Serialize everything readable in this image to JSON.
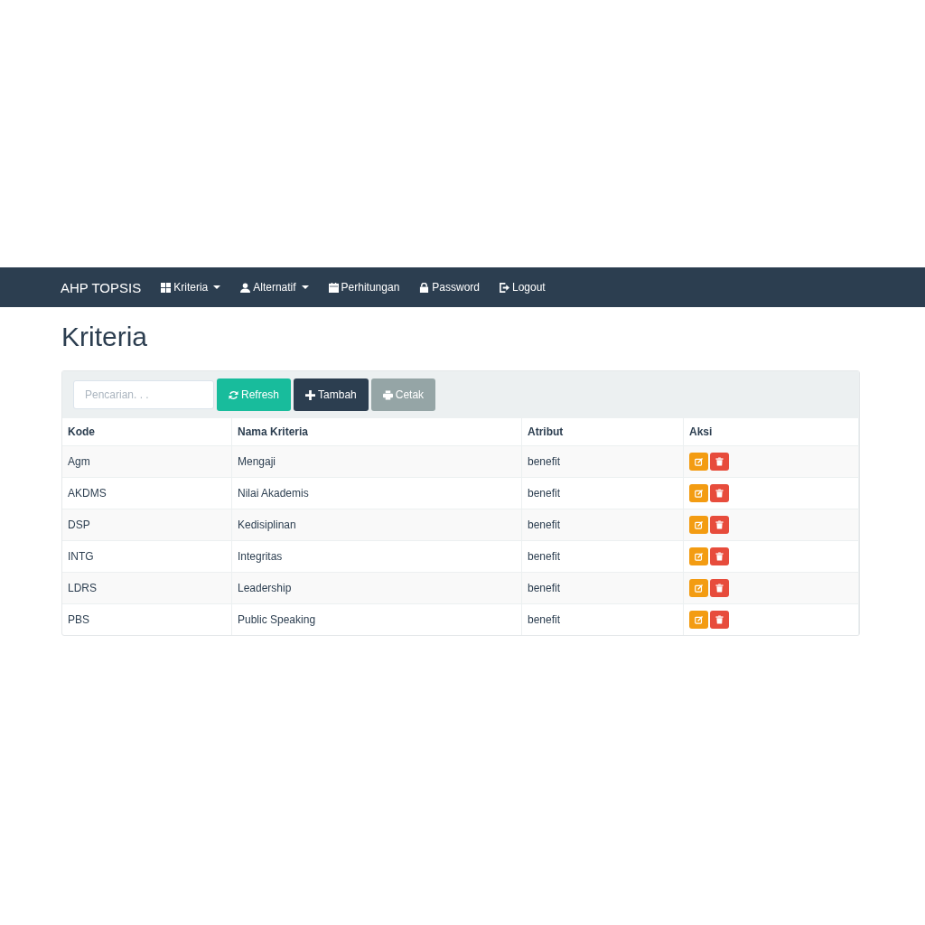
{
  "navbar": {
    "brand": "AHP TOPSIS",
    "items": [
      {
        "label": "Kriteria",
        "kind": "grid",
        "dropdown": true
      },
      {
        "label": "Alternatif",
        "kind": "user",
        "dropdown": true
      },
      {
        "label": "Perhitungan",
        "kind": "calendar",
        "dropdown": false
      },
      {
        "label": "Password",
        "kind": "lock",
        "dropdown": false
      },
      {
        "label": "Logout",
        "kind": "logout",
        "dropdown": false
      }
    ]
  },
  "page_title": "Kriteria",
  "toolbar": {
    "search": {
      "placeholder": "Pencarian. . ."
    },
    "buttons": [
      {
        "label": "Refresh",
        "kind": "refresh"
      },
      {
        "label": "Tambah",
        "kind": "add"
      },
      {
        "label": "Cetak",
        "kind": "print"
      }
    ]
  },
  "table": {
    "columns": [
      "Kode",
      "Nama Kriteria",
      "Atribut",
      "Aksi"
    ],
    "rows": [
      {
        "kode": "Agm",
        "nama": "Mengaji",
        "atribut": "benefit"
      },
      {
        "kode": "AKDMS",
        "nama": "Nilai Akademis",
        "atribut": "benefit"
      },
      {
        "kode": "DSP",
        "nama": "Kedisiplinan",
        "atribut": "benefit"
      },
      {
        "kode": "INTG",
        "nama": "Integritas",
        "atribut": "benefit"
      },
      {
        "kode": "LDRS",
        "nama": "Leadership",
        "atribut": "benefit"
      },
      {
        "kode": "PBS",
        "nama": "Public Speaking",
        "atribut": "benefit"
      }
    ]
  }
}
